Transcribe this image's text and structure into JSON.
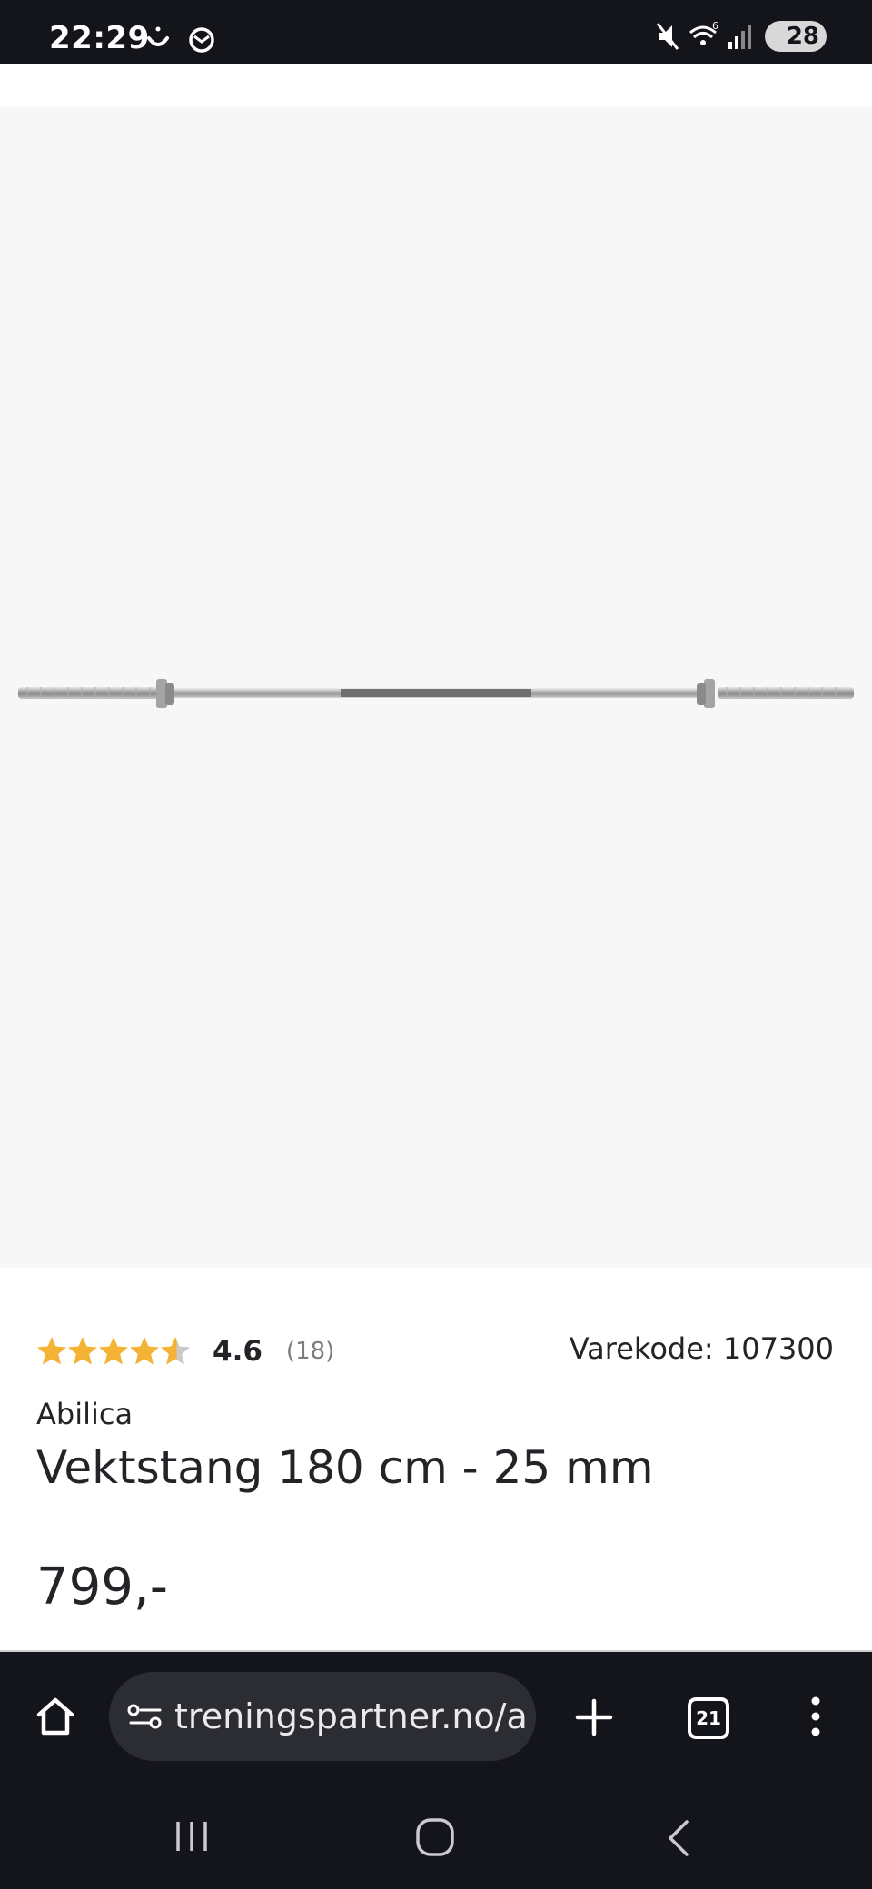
{
  "status_bar": {
    "time": "22:29",
    "battery": "28",
    "icons": [
      "smile-icon",
      "mail-icon",
      "mute-icon",
      "wifi-icon",
      "signal-icon",
      "battery-icon"
    ]
  },
  "product": {
    "rating": "4.6",
    "review_count": "(18)",
    "rating_stars": 4.6,
    "sku": "Varekode: 107300",
    "brand": "Abilica",
    "title": "Vektstang 180 cm - 25 mm",
    "price": "799,-",
    "image_icon": "barbell-image"
  },
  "browser": {
    "url": "treningspartner.no/a",
    "tab_count": "21",
    "icons": [
      "home-icon",
      "site-settings-icon",
      "new-tab-icon",
      "tabs-icon",
      "menu-icon"
    ]
  },
  "system_nav": {
    "icons": [
      "recents-icon",
      "home-circle-icon",
      "back-icon"
    ]
  },
  "colors": {
    "star": "#f5b335",
    "star_empty": "#c9c9c9",
    "bars": "#14151b",
    "image_bg": "#f7f7f7"
  }
}
